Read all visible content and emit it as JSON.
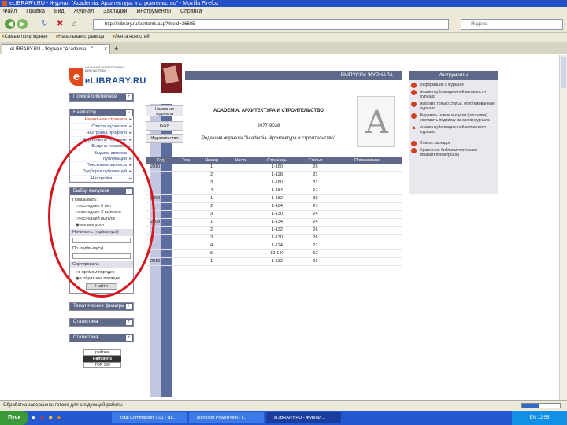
{
  "window": {
    "title": "eLIBRARY.RU - Журнал \"Academia. Архитектура и строительство\" - Mozilla Firefox"
  },
  "menu": [
    "Файл",
    "Правка",
    "Вид",
    "Журнал",
    "Закладки",
    "Инструменты",
    "Справка"
  ],
  "nav": {
    "url": "http://elibrary.ru/contents.asp?titleid=26685",
    "search_placeholder": "Яндекс"
  },
  "bookmarks": [
    "Самые популярные",
    "Начальная страница",
    "Лента новостей"
  ],
  "tab": {
    "label": "eLIBRARY.RU - Журнал \"Academia....\""
  },
  "logo": {
    "brand": "eLIBRARY.RU",
    "tagline": "НАУЧНАЯ ЭЛЕКТРОННАЯ БИБЛИОТЕКА"
  },
  "sidebar": {
    "search_title": "Поиск в библиотеке",
    "nav_title": "Навигатор",
    "nav_items": [
      "Начальная страница",
      "Список журналов",
      "Настройка профиля",
      "Журналы по тематике",
      "Выдача тематике",
      "Выдача авторов публикаций",
      "Поисковые запросы",
      "Подборка публикаций"
    ],
    "nav_button": "Настройки",
    "select_title": "Выбор выпусков",
    "show_label": "Показывать:",
    "show_options": [
      "последние 5 лет",
      "последние 3 выпуска",
      "последний выпуск",
      "все выпуски"
    ],
    "show_selected": 3,
    "from_label": "Начиная с (год/выпуск)",
    "to_label": "По (год/выпуск)",
    "sort_label": "Сортировать:",
    "sort_options": [
      "в прямом порядке",
      "в обратном порядке"
    ],
    "sort_selected": 1,
    "submit": "Найти",
    "panel2": "Тематические фильтры",
    "panel3": "Статистика",
    "panel4": "Статистика",
    "counter": [
      "рейтинг",
      "Rambler's",
      "TOP 100"
    ]
  },
  "header": {
    "title": "ВЫПУСКИ ЖУРНАЛА"
  },
  "journal": {
    "label_name": "Название журнала",
    "name": "ACADEMIA. АРХИТЕКТУРА И СТРОИТЕЛЬСТВО",
    "label_issn": "ISSN",
    "issn": "2077-9038",
    "label_publisher": "Издательство",
    "publisher": "Редакция журнала \"Academia. Архитектура и строительство\""
  },
  "table": {
    "columns": [
      "Год",
      "Том",
      "Номер",
      "Часть",
      "Страницы",
      "Статьи",
      "Примечание"
    ],
    "rows": [
      [
        "2010",
        "",
        "1",
        "",
        "1-160",
        "26",
        ""
      ],
      [
        "",
        "",
        "2",
        "",
        "1-128",
        "21",
        ""
      ],
      [
        "",
        "",
        "3",
        "",
        "1-160",
        "31",
        ""
      ],
      [
        "",
        "",
        "4",
        "",
        "1-184",
        "17",
        ""
      ],
      [
        "2009",
        "",
        "1",
        "",
        "1-182",
        "30",
        ""
      ],
      [
        "",
        "",
        "2",
        "",
        "1-184",
        "27",
        ""
      ],
      [
        "",
        "",
        "3",
        "",
        "1-130",
        "24",
        ""
      ],
      [
        "2008",
        "",
        "1",
        "",
        "1-134",
        "24",
        ""
      ],
      [
        "",
        "",
        "2",
        "",
        "1-132",
        "26",
        ""
      ],
      [
        "",
        "",
        "3",
        "",
        "1-130",
        "26",
        ""
      ],
      [
        "",
        "",
        "4",
        "",
        "1-124",
        "27",
        ""
      ],
      [
        "",
        "",
        "5",
        "",
        "12-140",
        "52",
        ""
      ],
      [
        "2010",
        "",
        "1",
        "",
        "1-132",
        "23",
        ""
      ]
    ]
  },
  "right": {
    "title": "Инструменты",
    "items": [
      "Информация о журнале",
      "Анализ публикационной активности журнала",
      "Выбрать только статьи, опубликованные журнала",
      "Выдавать новые выпуски (рассылка), составить подписку на архив журнала",
      "Анализ публикационной активности журнала",
      "Список закладок",
      "Сравнение библиометрических показателей журнала"
    ]
  },
  "status": {
    "text": "Обработка завершена: готово для следующей работы",
    "progress": 0.45
  },
  "taskbar": {
    "start": "Пуск",
    "tasks": [
      "Total Commander 7.01 - Na...",
      "Microsoft PowerPoint - [...",
      "eLIBRARY.RU - Журнал..."
    ],
    "clock": "EN 12:55"
  }
}
